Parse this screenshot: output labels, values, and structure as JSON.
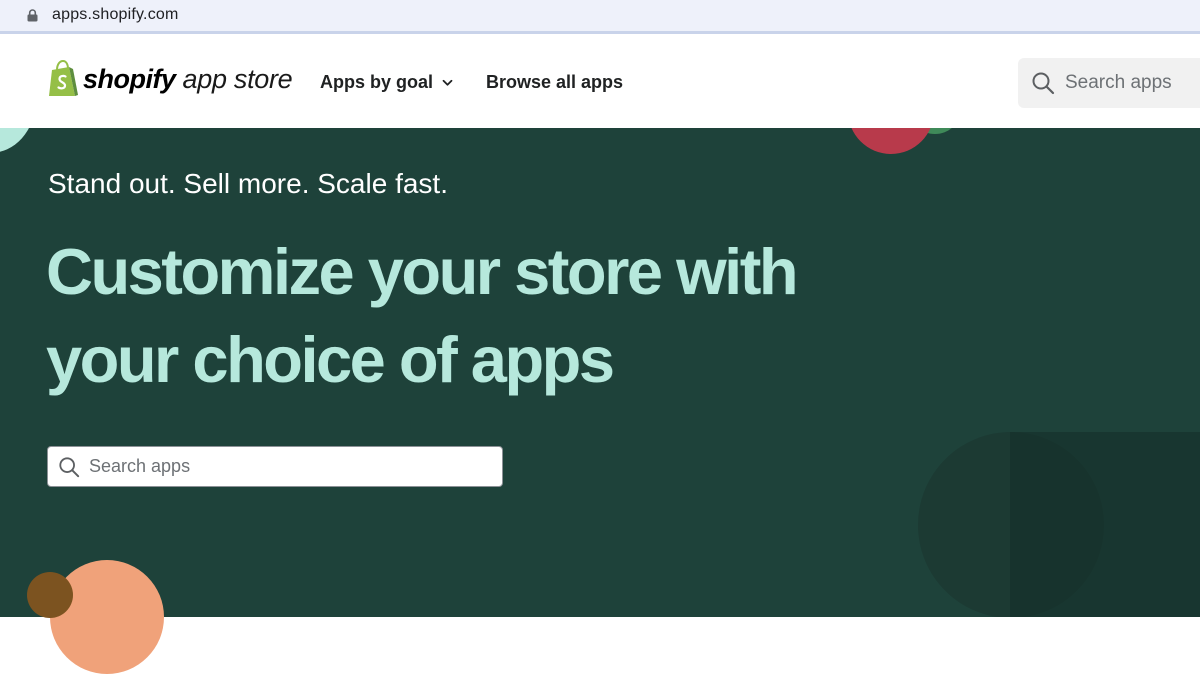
{
  "browser": {
    "url": "apps.shopify.com",
    "lock_icon": "lock-icon"
  },
  "header": {
    "logo": {
      "brand": "shopify",
      "product": "app store",
      "icon": "shopify-bag-icon",
      "brand_color": "#95bf47"
    },
    "nav": [
      {
        "label": "Apps by goal",
        "has_dropdown": true,
        "icon": "chevron-down-icon"
      },
      {
        "label": "Browse all apps",
        "has_dropdown": false
      }
    ],
    "search": {
      "placeholder": "Search apps",
      "icon": "search-icon"
    }
  },
  "hero": {
    "tagline": "Stand out. Sell more. Scale fast.",
    "headline_line1": "Customize your store with",
    "headline_line2": "your choice of apps",
    "search": {
      "placeholder": "Search apps",
      "icon": "search-icon"
    },
    "colors": {
      "background": "#1e423a",
      "headline": "#b6e8dc",
      "tagline": "#ffffff"
    }
  }
}
